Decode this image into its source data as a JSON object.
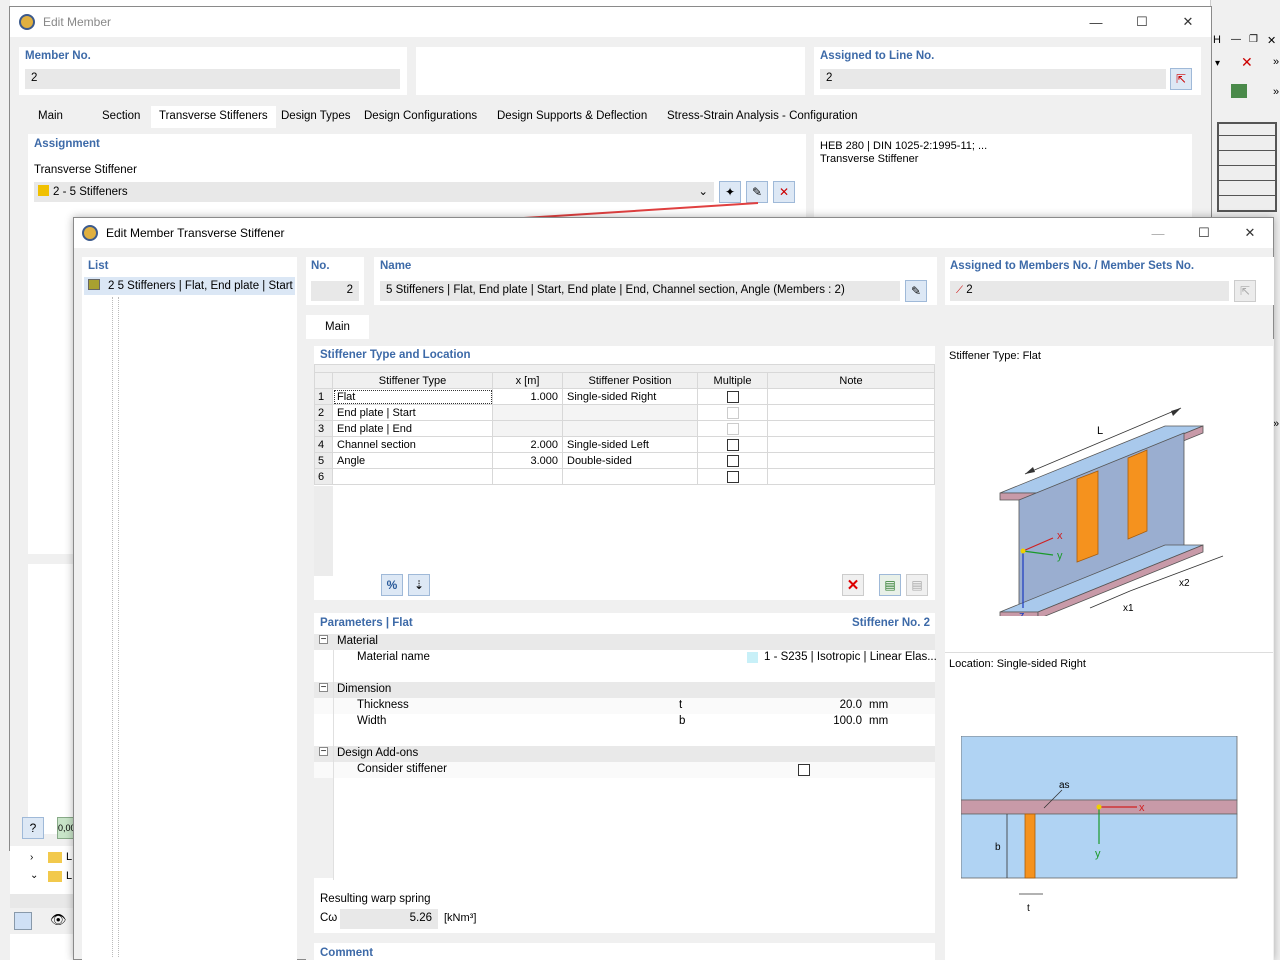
{
  "background_window": {
    "right_edge_items": [
      "H",
      "»",
      "»",
      "»"
    ]
  },
  "edit_member": {
    "title": "Edit Member",
    "member_no_label": "Member No.",
    "member_no_value": "2",
    "assigned_line_label": "Assigned to Line No.",
    "assigned_line_value": "2",
    "tabs": [
      "Main",
      "Section",
      "Transverse Stiffeners",
      "Design Types",
      "Design Configurations",
      "Design Supports & Deflection",
      "Stress-Strain Analysis - Configuration"
    ],
    "active_tab": "Transverse Stiffeners",
    "assignment_label": "Assignment",
    "transverse_stiffener_label": "Transverse Stiffener",
    "transverse_stiffener_value": "2 - 5 Stiffeners",
    "preview_line1": "HEB 280 | DIN 1025-2:1995-11; ...",
    "preview_line2": "Transverse Stiffener",
    "bottom_value": "0,00"
  },
  "nav_tree": {
    "items": [
      "L",
      "L"
    ]
  },
  "dialog": {
    "title": "Edit Member Transverse Stiffener",
    "list_label": "List",
    "list_item": "2  5 Stiffeners | Flat, End plate | Start",
    "no_label": "No.",
    "no_value": "2",
    "name_label": "Name",
    "name_value": "5 Stiffeners | Flat, End plate | Start, End plate | End, Channel section, Angle (Members : 2)",
    "assigned_label": "Assigned to Members No. / Member Sets No.",
    "assigned_value": "2",
    "tab_main": "Main",
    "stiffener_section_label": "Stiffener Type and Location",
    "table_headers": [
      "Stiffener Type",
      "x [m]",
      "Stiffener Position",
      "Multiple",
      "Note"
    ],
    "rows": [
      {
        "n": "1",
        "type": "Flat",
        "x": "1.000",
        "pos": "Single-sided Right",
        "multiple": "enabled"
      },
      {
        "n": "2",
        "type": "End plate | Start",
        "x": "",
        "pos": "",
        "multiple": "disabled"
      },
      {
        "n": "3",
        "type": "End plate | End",
        "x": "",
        "pos": "",
        "multiple": "disabled"
      },
      {
        "n": "4",
        "type": "Channel section",
        "x": "2.000",
        "pos": "Single-sided Left",
        "multiple": "enabled"
      },
      {
        "n": "5",
        "type": "Angle",
        "x": "3.000",
        "pos": "Double-sided",
        "multiple": "enabled"
      },
      {
        "n": "6",
        "type": "",
        "x": "",
        "pos": "",
        "multiple": "enabled"
      }
    ],
    "params_label": "Parameters | Flat",
    "stiffener_no_label": "Stiffener No. 2",
    "material_group": "Material",
    "material_name_label": "Material name",
    "material_name_value": "1 - S235 | Isotropic | Linear Elas...",
    "dimension_group": "Dimension",
    "thickness_label": "Thickness",
    "thickness_sym": "t",
    "thickness_value": "20.0",
    "thickness_unit": "mm",
    "width_label": "Width",
    "width_sym": "b",
    "width_value": "100.0",
    "width_unit": "mm",
    "addons_group": "Design Add-ons",
    "consider_label": "Consider stiffener",
    "warp_label": "Resulting warp spring",
    "warp_sym": "Cω",
    "warp_value": "5.26",
    "warp_unit": "[kNm³]",
    "comment_label": "Comment",
    "type_caption": "Stiffener Type: Flat",
    "location_caption": "Location: Single-sided Right",
    "fig_L": "L",
    "fig_x": "x",
    "fig_y": "y",
    "fig_z": "z",
    "fig_x1": "x1",
    "fig_x2": "x2",
    "fig_as": "as",
    "fig_b": "b",
    "fig_t": "t"
  },
  "colors": {
    "accent_blue": "#3d6aa8",
    "stiffener_orange": "#f5921e",
    "beam_blue": "#a9c9ec",
    "flange_pink": "#c89aa8",
    "arrow_red": "#e04040"
  }
}
